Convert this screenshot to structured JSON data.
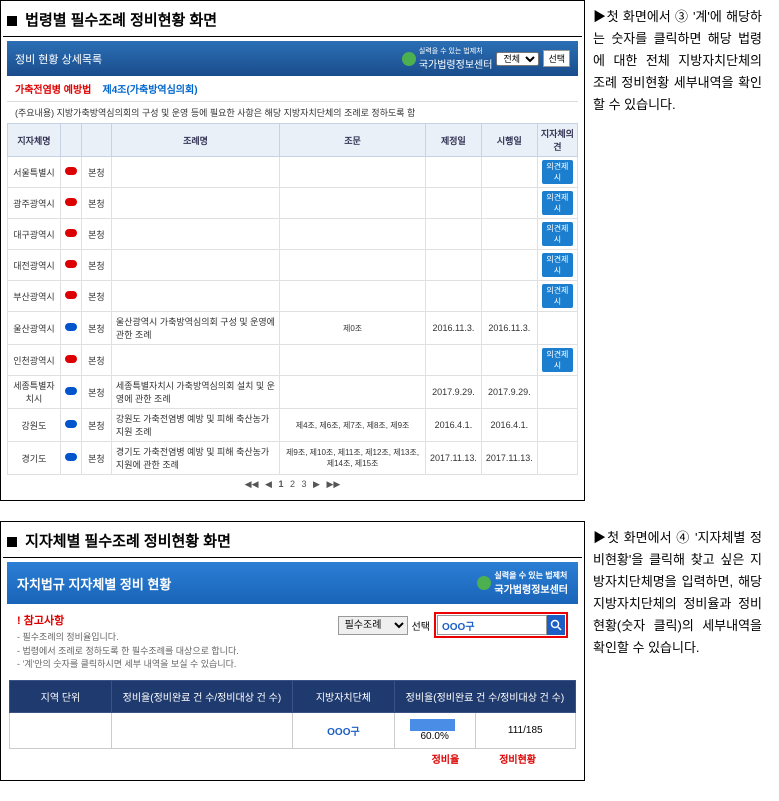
{
  "section1": {
    "title": "법령별 필수조례 정비현황 화면",
    "header": "정비 현황 상세목록",
    "logo_top": "실력을 수 있는 법제처",
    "logo": "국가법령정보센터",
    "select_all": "전체",
    "btn_sel": "선택",
    "breadcrumb": {
      "a": "가축전염병 예방법",
      "b": "제4조(가축방역심의회)"
    },
    "desc": "(주요내용) 지방가축방역심의회의 구성 및 운영 등에 필요한 사항은 해당 지방자치단체의 조례로 정하도록 함",
    "cols": [
      "지자체명",
      "",
      "",
      "조례명",
      "조문",
      "제정일",
      "시행일",
      "지자체의견"
    ],
    "rows": [
      {
        "c1": "서울특별시",
        "dot": "red",
        "c3": "본청",
        "c4": "",
        "c5": "",
        "c6": "",
        "c7": "",
        "op": true,
        "hl": false
      },
      {
        "c1": "광주광역시",
        "dot": "red",
        "c3": "본청",
        "c4": "",
        "c5": "",
        "c6": "",
        "c7": "",
        "op": true,
        "hl": false
      },
      {
        "c1": "대구광역시",
        "dot": "red",
        "c3": "본청",
        "c4": "",
        "c5": "",
        "c6": "",
        "c7": "",
        "op": true,
        "hl": true
      },
      {
        "c1": "대전광역시",
        "dot": "red",
        "c3": "본청",
        "c4": "",
        "c5": "",
        "c6": "",
        "c7": "",
        "op": true,
        "hl": false
      },
      {
        "c1": "부산광역시",
        "dot": "red",
        "c3": "본청",
        "c4": "",
        "c5": "",
        "c6": "",
        "c7": "",
        "op": true,
        "hl": false
      },
      {
        "c1": "울산광역시",
        "dot": "blue",
        "c3": "본청",
        "c4": "울산광역시 가축방역심의회 구성 및 운영에 관한 조례",
        "c5": "제0조",
        "c6": "2016.11.3.",
        "c7": "2016.11.3.",
        "op": false,
        "hl": true
      },
      {
        "c1": "인천광역시",
        "dot": "red",
        "c3": "본청",
        "c4": "",
        "c5": "",
        "c6": "",
        "c7": "",
        "op": true,
        "hl": false
      },
      {
        "c1": "세종특별자치시",
        "dot": "blue",
        "c3": "본청",
        "c4": "세종특별자치시 가축방역심의회 설치 및 운영에 관한 조례",
        "c5": "",
        "c6": "2017.9.29.",
        "c7": "2017.9.29.",
        "op": false,
        "hl": false
      },
      {
        "c1": "강원도",
        "dot": "blue",
        "c3": "본청",
        "c4": "강원도 가축전염병 예방 및 피해 축산농가 지원 조례",
        "c5": "제4조, 제6조, 제7조, 제8조, 제9조",
        "c6": "2016.4.1.",
        "c7": "2016.4.1.",
        "op": false,
        "hl": false
      },
      {
        "c1": "경기도",
        "dot": "blue",
        "c3": "본청",
        "c4": "경기도 가축전염병 예방 및 피해 축산농가 지원에 관한 조례",
        "c5": "제9조, 제10조, 제11조, 제12조, 제13조, 제14조, 제15조",
        "c6": "2017.11.13.",
        "c7": "2017.11.13.",
        "op": false,
        "hl": false
      }
    ],
    "opinion_label": "의견제시",
    "pager": {
      "first": "◀◀",
      "prev": "◀",
      "p1": "1",
      "p2": "2",
      "p3": "3",
      "next": "▶",
      "last": "▶▶"
    },
    "side": "첫 화면에서 ③ '계'에 해당하는 숫자를 클릭하면 해당 법령에 대한 전체 지방자치단체의 조례 정비현황 세부내역을 확인할 수 있습니다."
  },
  "section2": {
    "title": "지자체별 필수조례 정비현황 화면",
    "header": "자치법규 지자체별 정비 현황",
    "logo_top": "실력을 수 있는 법제처",
    "logo": "국가법령정보센터",
    "ref_title": "참고사항",
    "ref_items": [
      "- 필수조례의 정비율입니다.",
      "- 법령에서 조례로 정하도록 한 필수조례를 대상으로 합니다.",
      "- '계'안의 숫자를 클릭하시면 세부 내역을 보실 수 있습니다."
    ],
    "sel_label": "필수조례",
    "btn_sel": "선택",
    "search_val": "OOO구",
    "cols2a": [
      "지역 단위",
      "정비율(정비완료 건 수/정비대상 건 수)"
    ],
    "cols2b": [
      "지방자치단체",
      "정비율(정비완료 건 수/정비대상 건 수)"
    ],
    "row": {
      "c1": "OOO구",
      "pct": "60.0%",
      "ratio": "111/185"
    },
    "foot": {
      "a": "정비율",
      "b": "정비현황"
    },
    "side": "첫 화면에서 ④ '지자체별 정비현황'을 클릭해 찾고 싶은 지방자치단체명을 입력하면, 해당 지방자치단체의 정비율과 정비현황(숫자 클릭)의 세부내역을 확인할 수 있습니다."
  }
}
